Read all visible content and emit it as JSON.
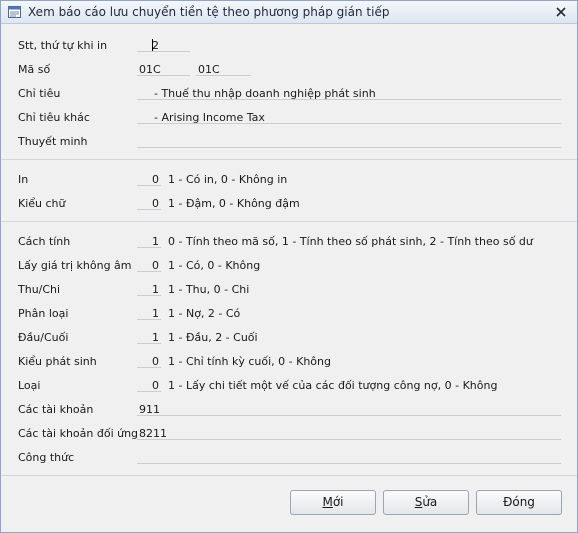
{
  "window": {
    "title": "Xem báo cáo lưu chuyển tiền tệ theo phương pháp gián tiếp"
  },
  "labels": {
    "stt": "Stt, thứ tự khi in",
    "ma_so": "Mã số",
    "chi_tieu": "Chỉ tiêu",
    "chi_tieu_khac": "Chỉ tiêu khác",
    "thuyet_minh": "Thuyết minh",
    "in": "In",
    "kieu_chu": "Kiểu chữ",
    "cach_tinh": "Cách tính",
    "lay_gia_tri": "Lấy giá trị không âm",
    "thu_chi": "Thu/Chi",
    "phan_loai": "Phân loại",
    "dau_cuoi": "Đầu/Cuối",
    "kieu_phat_sinh": "Kiểu phát sinh",
    "loai": "Loại",
    "cac_tai_khoan": "Các tài khoản",
    "cac_tai_khoan_doi_ung": "Các tài khoản đối ứng",
    "cong_thuc": "Công thức"
  },
  "values": {
    "stt": "2",
    "ma_so_1": "01C",
    "ma_so_2": "01C",
    "chi_tieu": "- Thuế thu nhập doanh nghiệp phát sinh",
    "chi_tieu_khac": "- Arising Income Tax",
    "thuyet_minh": "",
    "in": "0",
    "kieu_chu": "0",
    "cach_tinh": "1",
    "lay_gia_tri": "0",
    "thu_chi": "1",
    "phan_loai": "1",
    "dau_cuoi": "1",
    "kieu_phat_sinh": "0",
    "loai": "0",
    "cac_tai_khoan": "911",
    "cac_tai_khoan_doi_ung": "8211",
    "cong_thuc": ""
  },
  "hints": {
    "in": "1 - Có in, 0 - Không in",
    "kieu_chu": "1 - Đậm, 0 - Không đậm",
    "cach_tinh": "0 - Tính theo mã số, 1 - Tính theo số phát sinh, 2 - Tính theo số dư",
    "lay_gia_tri": "1 - Có, 0 - Không",
    "thu_chi": "1 - Thu, 0 - Chi",
    "phan_loai": "1 - Nợ, 2 - Có",
    "dau_cuoi": "1 - Đầu, 2 - Cuối",
    "kieu_phat_sinh": "1 - Chỉ tính kỳ cuối, 0 - Không",
    "loai": "1 - Lấy chi tiết một vế của các đối tượng công nợ, 0 - Không"
  },
  "buttons": {
    "moi": {
      "mnemonic": "M",
      "rest": "ới"
    },
    "sua": {
      "mnemonic": "S",
      "rest": "ửa"
    },
    "dong": {
      "mnemonic": "",
      "rest": "Đóng"
    }
  },
  "colors": {
    "title_bar": "#dde6f1",
    "border": "#8ea6c6",
    "background": "#f0f0f0"
  },
  "icons": {
    "window": "report-window-icon",
    "close": "close-icon"
  }
}
